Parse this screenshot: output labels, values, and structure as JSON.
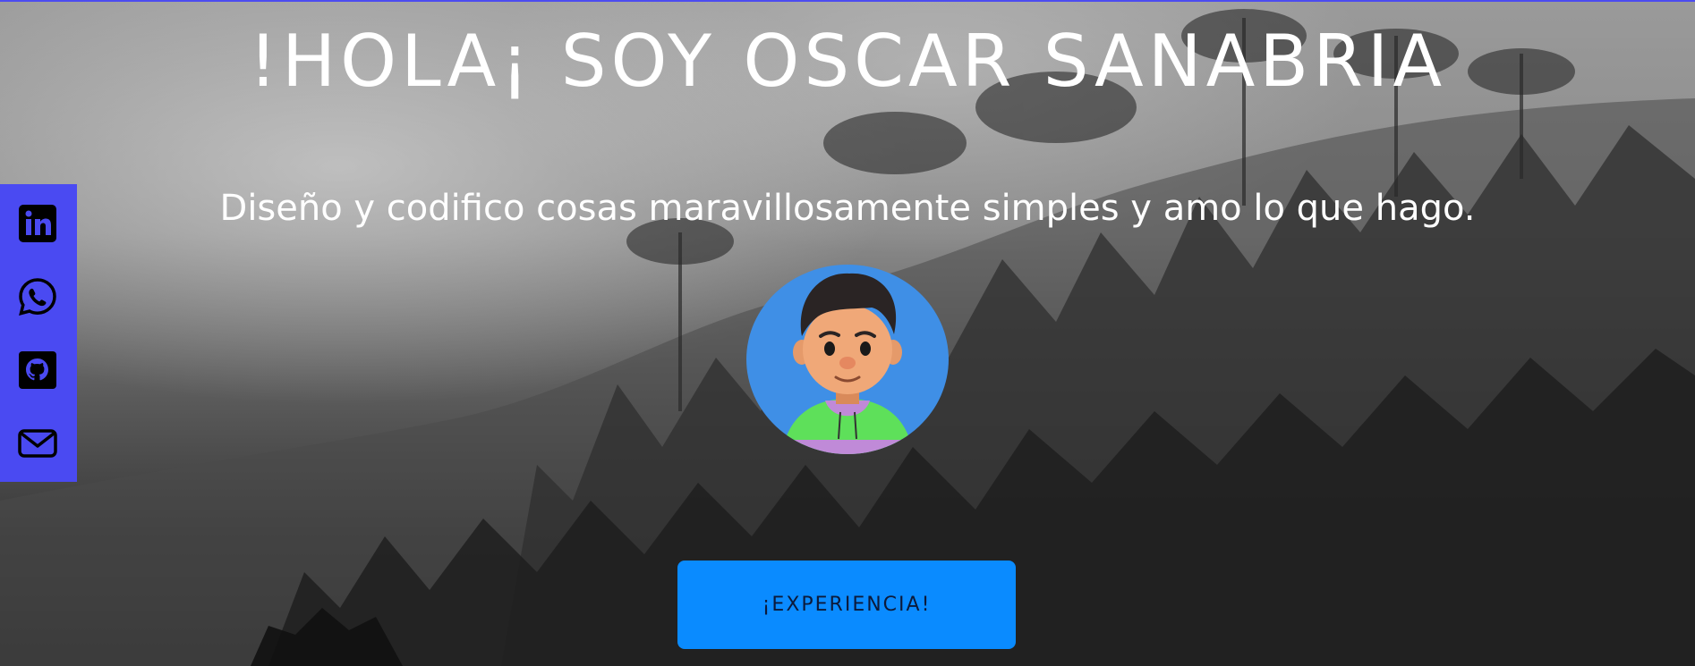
{
  "hero": {
    "title": "!HOLA¡ SOY OSCAR SANABRIA",
    "subtitle": "Diseño y codifico cosas maravillosamente simples y amo lo que hago.",
    "cta_label": "¡EXPERIENCIA!"
  },
  "social": {
    "items": [
      {
        "icon": "linkedin-icon"
      },
      {
        "icon": "whatsapp-icon"
      },
      {
        "icon": "github-icon"
      },
      {
        "icon": "mail-icon"
      }
    ]
  },
  "colors": {
    "accent": "#4a4af2",
    "button": "#0a8bff",
    "avatar_bg": "#3f8fe6",
    "text": "#ffffff"
  }
}
